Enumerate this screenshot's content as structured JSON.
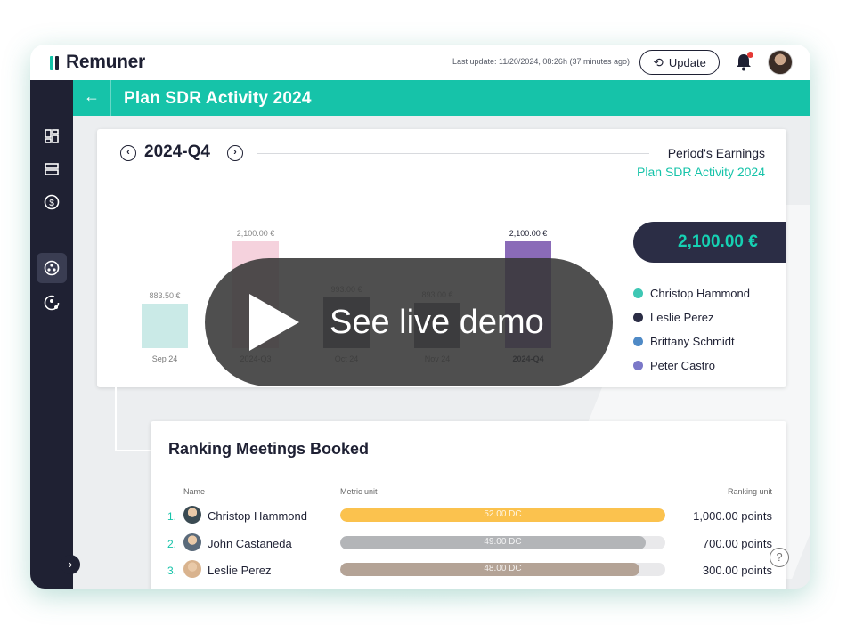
{
  "app": {
    "name": "Remuner"
  },
  "topbar": {
    "last_update": "Last update: 11/20/2024, 08:26h (37 minutes ago)",
    "update_label": "Update"
  },
  "header": {
    "title": "Plan SDR Activity 2024"
  },
  "period": {
    "label": "2024-Q4",
    "earnings_label": "Period's Earnings",
    "plan_name": "Plan SDR Activity 2024",
    "total": "2,100.00 €"
  },
  "chart_data": {
    "type": "bar",
    "categories": [
      "Sep 24",
      "2024-Q3",
      "Oct 24",
      "Nov 24",
      "2024-Q4"
    ],
    "value_labels": [
      "883.50 €",
      "2,100.00 €",
      "993.00 €",
      "893.00 €",
      "2,100.00 €"
    ],
    "values": [
      883.5,
      2100,
      993,
      893,
      2100
    ],
    "ylim": [
      0,
      2100
    ],
    "colors": [
      "#b8e3df",
      "#f2c3d2",
      "#2b2d45",
      "#2b2d45",
      "#8a6bb8"
    ],
    "legend": [
      {
        "name": "Christop Hammond",
        "color": "#3ec7b4"
      },
      {
        "name": "Leslie Perez",
        "color": "#2b2d45"
      },
      {
        "name": "Brittany Schmidt",
        "color": "#4f8ac6"
      },
      {
        "name": "Peter Castro",
        "color": "#7b78c8"
      }
    ]
  },
  "ranking": {
    "title": "Ranking Meetings Booked",
    "columns": {
      "name": "Name",
      "metric": "Metric unit",
      "ranking": "Ranking unit"
    },
    "rows": [
      {
        "rank": "1.",
        "name": "Christop Hammond",
        "metric": "52.00 DC",
        "fraction": 1.0,
        "points": "1,000.00 points",
        "color": "#fbc24e",
        "avatar": "#3a4a52"
      },
      {
        "rank": "2.",
        "name": "John Castaneda",
        "metric": "49.00 DC",
        "fraction": 0.94,
        "points": "700.00 points",
        "color": "#b3b5b8",
        "avatar": "#5a6a7a"
      },
      {
        "rank": "3.",
        "name": "Leslie Perez",
        "metric": "48.00 DC",
        "fraction": 0.92,
        "points": "300.00 points",
        "color": "#b4a396",
        "avatar": "#d9b38e"
      }
    ]
  },
  "overlay": {
    "label": "See live demo"
  }
}
